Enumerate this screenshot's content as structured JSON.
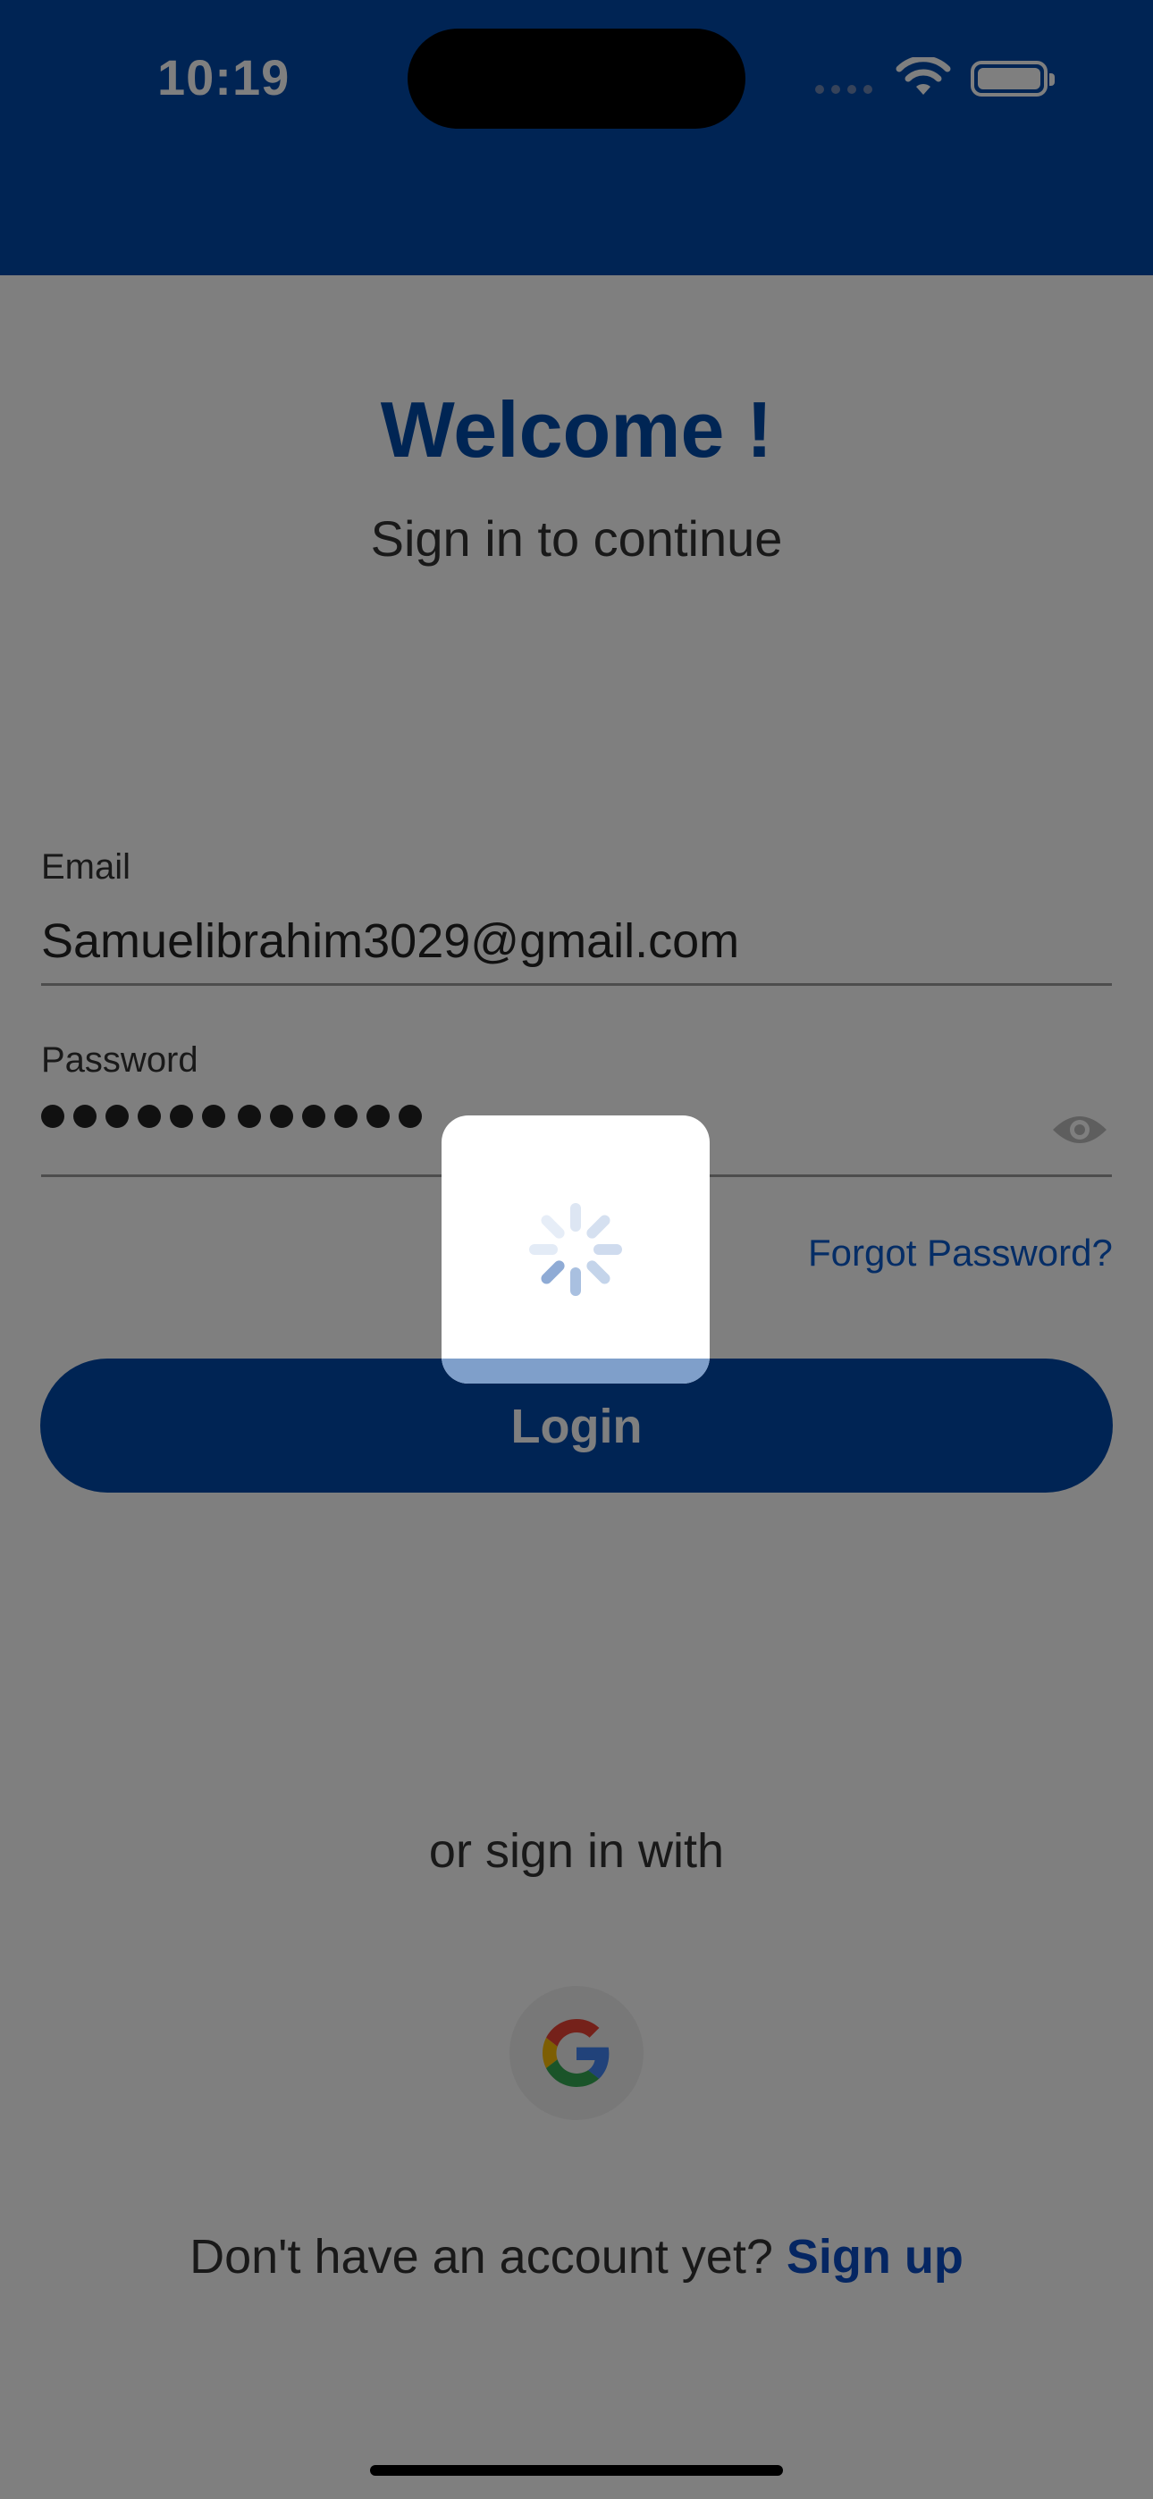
{
  "status_bar": {
    "time": "10:19"
  },
  "welcome": {
    "title": "Welcome !",
    "subtitle": "Sign in to continue"
  },
  "form": {
    "email_label": "Email",
    "email_value": "Samuelibrahim3029@gmail.com",
    "password_label": "Password",
    "password_masked_length": 12,
    "forgot_password": "Forgot Password?",
    "login_label": "Login"
  },
  "alt_signin": {
    "label": "or sign in with",
    "provider_icon": "google-icon"
  },
  "signup": {
    "prompt": "Don't have an account yet?",
    "link": "Sign up"
  },
  "loading": {
    "icon": "spinner-icon"
  },
  "colors": {
    "brand_blue": "#0048a8",
    "title_blue": "#004aa8",
    "link_blue": "#0b5bcc",
    "overlay": "rgba(0,0,0,0.5)"
  }
}
